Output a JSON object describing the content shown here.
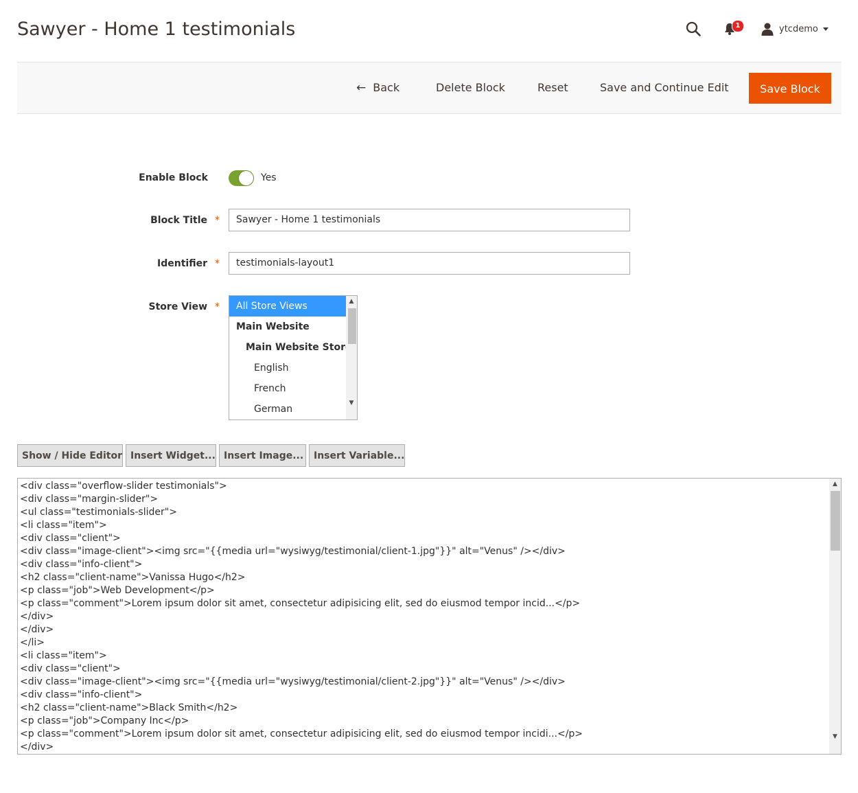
{
  "header": {
    "title": "Sawyer - Home 1 testimonials",
    "notifications_count": "1",
    "user_name": "ytcdemo"
  },
  "actions": {
    "back": "Back",
    "delete": "Delete Block",
    "reset": "Reset",
    "save_continue": "Save and Continue Edit",
    "save": "Save Block"
  },
  "form": {
    "enable_block": {
      "label": "Enable Block",
      "value": "Yes",
      "on": true
    },
    "block_title": {
      "label": "Block Title",
      "value": "Sawyer - Home 1 testimonials"
    },
    "identifier": {
      "label": "Identifier",
      "value": "testimonials-layout1"
    },
    "store_view": {
      "label": "Store View",
      "options": [
        {
          "label": "All Store Views",
          "selected": true
        },
        {
          "label": "Main Website"
        },
        {
          "label": "Main Website Store"
        },
        {
          "label": "English"
        },
        {
          "label": "French"
        },
        {
          "label": "German"
        }
      ]
    },
    "required_mark": "*"
  },
  "editor": {
    "buttons": {
      "show_hide": "Show / Hide Editor",
      "insert_widget": "Insert Widget...",
      "insert_image": "Insert Image...",
      "insert_variable": "Insert Variable..."
    },
    "content_lines": [
      "<div class=\"overflow-slider testimonials\">",
      "<div class=\"margin-slider\">",
      "<ul class=\"testimonials-slider\">",
      "<li class=\"item\">",
      "<div class=\"client\">",
      "<div class=\"image-client\"><img src=\"{{media url=\"wysiwyg/testimonial/client-1.jpg\"}}\" alt=\"Venus\" /></div>",
      "<div class=\"info-client\">",
      "<h2 class=\"client-name\">Vanissa Hugo</h2>",
      "<p class=\"job\">Web Development</p>",
      "<p class=\"comment\">Lorem ipsum dolor sit amet, consectetur adipisicing elit, sed do eiusmod tempor incid...</p>",
      "</div>",
      "</div>",
      "</li>",
      "<li class=\"item\">",
      "<div class=\"client\">",
      "<div class=\"image-client\"><img src=\"{{media url=\"wysiwyg/testimonial/client-2.jpg\"}}\" alt=\"Venus\" /></div>",
      "<div class=\"info-client\">",
      "<h2 class=\"client-name\">Black Smith</h2>",
      "<p class=\"job\">Company Inc</p>",
      "<p class=\"comment\">Lorem ipsum dolor sit amet, consectetur adipisicing elit, sed do eiusmod tempor incidi...</p>",
      "</div>"
    ]
  },
  "colors": {
    "primary": "#eb5202",
    "toggle_on": "#79a22e",
    "selected_option": "#3399ff",
    "badge": "#e22626"
  },
  "icons": {
    "search": "search-icon",
    "notifications": "bell-icon",
    "user": "user-icon",
    "back": "arrow-left-icon"
  }
}
